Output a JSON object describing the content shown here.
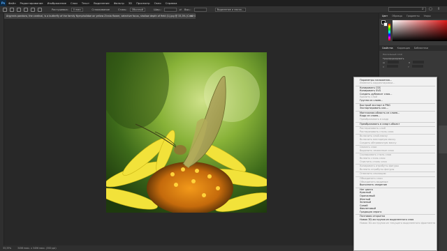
{
  "app": {
    "logo": "Ps"
  },
  "menu": [
    "Файл",
    "Редактирование",
    "Изображение",
    "Слои",
    "Текст",
    "Выделение",
    "Фильтр",
    "3D",
    "Просмотр",
    "Окно",
    "Справка"
  ],
  "options": {
    "feather_label": "Растушевка:",
    "feather_value": "0 пикс",
    "smoothing_label": "Сглаживание",
    "style_label": "Стиль:",
    "style_value": "Обычный",
    "width_label": "Шир.:",
    "height_label": "Выс.:",
    "select_mask": "Выделение и маска..."
  },
  "document": {
    "tab_title": "Argynnis pandora, the cardinal, is a butterfly of the family Nymphalidae on yellow Zinnia flower, selective focus, shallow depth of field (1).jpg @ 33,3% (Слой 0, RGB/8*)",
    "close": "×"
  },
  "status": {
    "zoom": "33,33%",
    "size": "3456 пикс. x 3456 пикс. (300 ppi)"
  },
  "panel": {
    "tabs_top": [
      "Цвет",
      "Образцы",
      "Градиенты",
      "Узоры"
    ],
    "tabs_props": [
      "Свойства",
      "Коррекция",
      "Библиотеки"
    ],
    "pixel_layer": "Пиксельный слой",
    "transform": "Трансформировать",
    "w_label": "Ш",
    "h_label": "В",
    "x_label": "X",
    "y_label": "Y"
  },
  "context_menu": {
    "items": [
      {
        "label": "Параметры наложения...",
        "disabled": false
      },
      {
        "label": "Изменить корректировки...",
        "disabled": true
      },
      {
        "sep": true
      },
      {
        "label": "Копировать CSS",
        "disabled": false
      },
      {
        "label": "Копировать SVG",
        "disabled": false
      },
      {
        "label": "Создать дубликат слоя...",
        "disabled": false
      },
      {
        "label": "Удалить слой",
        "disabled": true
      },
      {
        "label": "Группа из слоев...",
        "disabled": false
      },
      {
        "sep": true
      },
      {
        "label": "Быстрый экспорт в PNG",
        "disabled": false
      },
      {
        "label": "Экспортировать как...",
        "disabled": false
      },
      {
        "sep": true
      },
      {
        "label": "Монтажная область из слоев...",
        "disabled": false
      },
      {
        "label": "Кадр из слоев...",
        "disabled": false
      },
      {
        "label": "Преобразовать в кадр",
        "disabled": true
      },
      {
        "sep": true
      },
      {
        "label": "Преобразовать в смарт-объект",
        "disabled": false
      },
      {
        "sep": true
      },
      {
        "label": "Растеризовать слой",
        "disabled": true
      },
      {
        "label": "Растеризовать стиль слоя",
        "disabled": true
      },
      {
        "sep": true
      },
      {
        "label": "Включить слой-маску",
        "disabled": true
      },
      {
        "label": "Включить векторную маску",
        "disabled": true
      },
      {
        "label": "Создать обтравочную маску",
        "disabled": true
      },
      {
        "sep": true
      },
      {
        "label": "Связать слои",
        "disabled": true
      },
      {
        "label": "Выделить связанные слои",
        "disabled": true
      },
      {
        "sep": true
      },
      {
        "label": "Скопировать стиль слоя",
        "disabled": true
      },
      {
        "label": "Вклеить стиль слоя",
        "disabled": true
      },
      {
        "label": "Очистить стиль слоя",
        "disabled": true
      },
      {
        "sep": true
      },
      {
        "label": "Копировать атрибуты фигуры",
        "disabled": true
      },
      {
        "label": "Вклеить атрибуты фигуры",
        "disabled": true
      },
      {
        "sep": true
      },
      {
        "label": "Отменить изоляцию",
        "disabled": true
      },
      {
        "sep": true
      },
      {
        "label": "Объединить слои",
        "disabled": true
      },
      {
        "label": "Объединить видимые",
        "disabled": true
      },
      {
        "label": "Выполнить сведение",
        "disabled": false
      },
      {
        "sep": true
      },
      {
        "label": "Нет цвета",
        "disabled": false
      },
      {
        "label": "Красный",
        "disabled": false
      },
      {
        "label": "Оранжевый",
        "disabled": false
      },
      {
        "label": "Желтый",
        "disabled": false
      },
      {
        "label": "Зеленый",
        "disabled": false
      },
      {
        "label": "Синий",
        "disabled": false
      },
      {
        "label": "Фиолетовый",
        "disabled": false
      },
      {
        "label": "Градация серого",
        "disabled": false
      },
      {
        "sep": true
      },
      {
        "label": "Почтовая открытка",
        "disabled": false
      },
      {
        "label": "Новая 3D-экструзия из выделенного слоя",
        "disabled": false
      },
      {
        "label": "Новая 3D-экструзия из текущего выделенного фрагмента",
        "disabled": true
      }
    ]
  },
  "colors": {
    "menubar": "#1f1f1f",
    "canvas": "#282828",
    "menu_bg": "#f1f1f1",
    "disabled_text": "#9c9c9c"
  }
}
